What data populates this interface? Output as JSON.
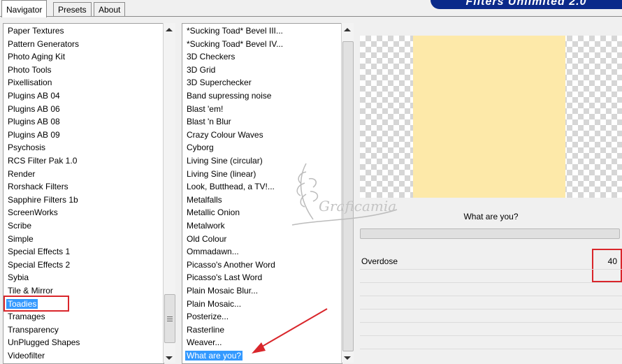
{
  "tabs": [
    {
      "label": "Navigator",
      "active": true
    },
    {
      "label": "Presets",
      "active": false
    },
    {
      "label": "About",
      "active": false
    }
  ],
  "brand": {
    "title": "Filters Unlimited 2.0"
  },
  "categories": {
    "items": [
      "Paper Textures",
      "Pattern Generators",
      "Photo Aging Kit",
      "Photo Tools",
      "Pixellisation",
      "Plugins AB 04",
      "Plugins AB 06",
      "Plugins AB 08",
      "Plugins AB 09",
      "Psychosis",
      "RCS Filter Pak 1.0",
      "Render",
      "Rorshack Filters",
      "Sapphire Filters 1b",
      "ScreenWorks",
      "Scribe",
      "Simple",
      "Special Effects 1",
      "Special Effects 2",
      "Sybia",
      "Tile & Mirror",
      "Toadies",
      "Tramages",
      "Transparency",
      "UnPlugged Shapes",
      "Videofilter"
    ],
    "selected": "Toadies"
  },
  "filters": {
    "items": [
      "*Sucking Toad*  Bevel III...",
      "*Sucking Toad*  Bevel IV...",
      "3D Checkers",
      "3D Grid",
      "3D Superchecker",
      "Band supressing noise",
      "Blast 'em!",
      "Blast 'n Blur",
      "Crazy Colour Waves",
      "Cyborg",
      "Living Sine (circular)",
      "Living Sine (linear)",
      "Look, Butthead, a TV!...",
      "Metalfalls",
      "Metallic Onion",
      "Metalwork",
      "Old Colour",
      "Ommadawn...",
      "Picasso's Another Word",
      "Picasso's Last Word",
      "Plain Mosaic Blur...",
      "Plain Mosaic...",
      "Posterize...",
      "Rasterline",
      "Weaver...",
      "What are you?"
    ],
    "selected": "What are you?"
  },
  "filter_panel": {
    "name": "What are you?",
    "params": [
      {
        "label": "Overdose",
        "value": "40"
      }
    ]
  },
  "colors": {
    "accent": "#d9262b",
    "selection": "#3399ff",
    "preview_fill": "#fde9a9",
    "brand": "#0a2a8a"
  },
  "watermark": {
    "text": "Graficamia"
  }
}
